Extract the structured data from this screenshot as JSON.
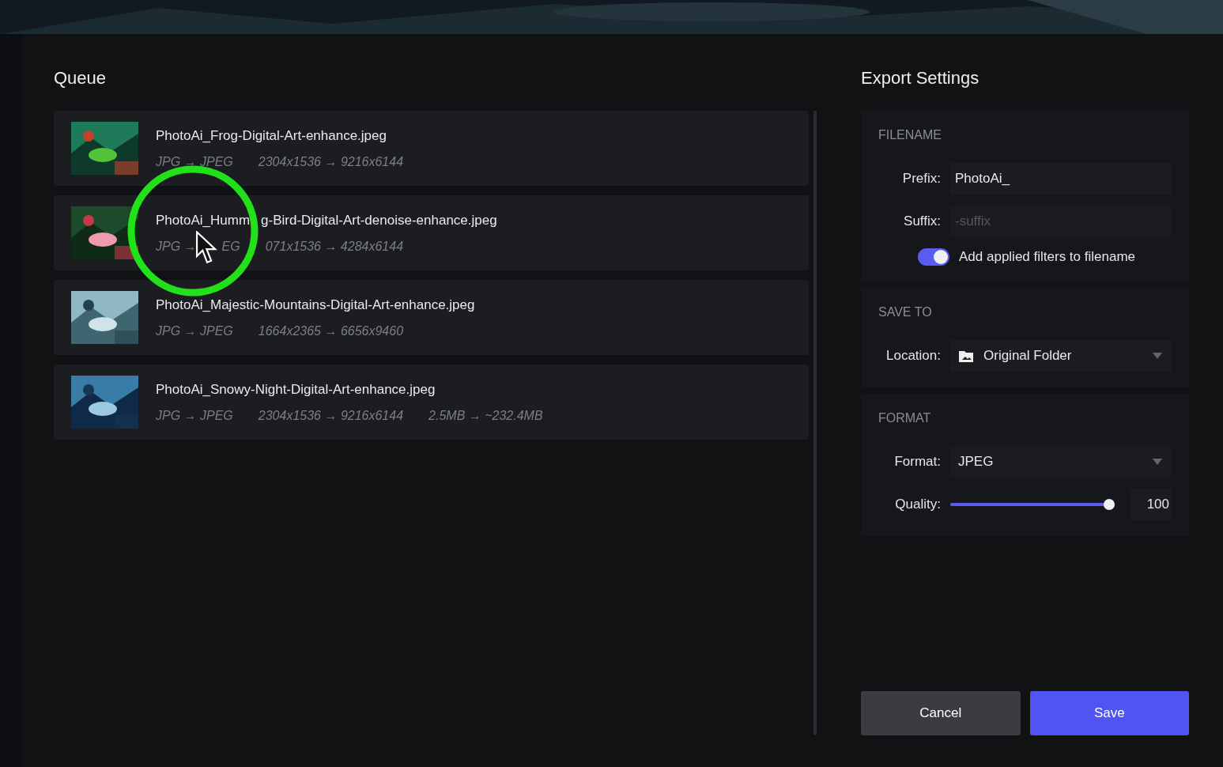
{
  "queue": {
    "title": "Queue",
    "items": [
      {
        "name": [
          "PhotoAi_Frog-Digital-Art-enhance.jpeg"
        ],
        "meta": [
          "JPG → JPEG",
          "2304x1536 → 9216x6144"
        ]
      },
      {
        "name": [
          "PhotoAi_Humm",
          "g-Bird-Digital-Art-denoise-enhance.jpeg"
        ],
        "meta": [
          "JPG →",
          "EG",
          "071x1536 → 4284x6144"
        ]
      },
      {
        "name": [
          "PhotoAi_Majestic-Mountains-Digital-Art-enhance.jpeg"
        ],
        "meta": [
          "JPG → JPEG",
          "1664x2365 → 6656x9460"
        ]
      },
      {
        "name": [
          "PhotoAi_Snowy-Night-Digital-Art-enhance.jpeg"
        ],
        "meta": [
          "JPG → JPEG",
          "2304x1536 → 9216x6144",
          "2.5MB → ~232.4MB"
        ]
      }
    ]
  },
  "export": {
    "title": "Export Settings",
    "filename": {
      "heading": "FILENAME",
      "prefix": {
        "label": "Prefix:",
        "value": "PhotoAi_"
      },
      "suffix": {
        "label": "Suffix:",
        "placeholder": "-suffix"
      },
      "add_filters": {
        "label": "Add applied filters to filename",
        "on": true
      }
    },
    "save_to": {
      "heading": "SAVE TO",
      "location": {
        "label": "Location:",
        "value": "Original Folder"
      }
    },
    "format": {
      "heading": "FORMAT",
      "format": {
        "label": "Format:",
        "value": "JPEG"
      },
      "quality": {
        "label": "Quality:",
        "level": 1,
        "reading": "100"
      }
    }
  },
  "buttons": {
    "cancel": "Cancel",
    "save": "Save"
  }
}
